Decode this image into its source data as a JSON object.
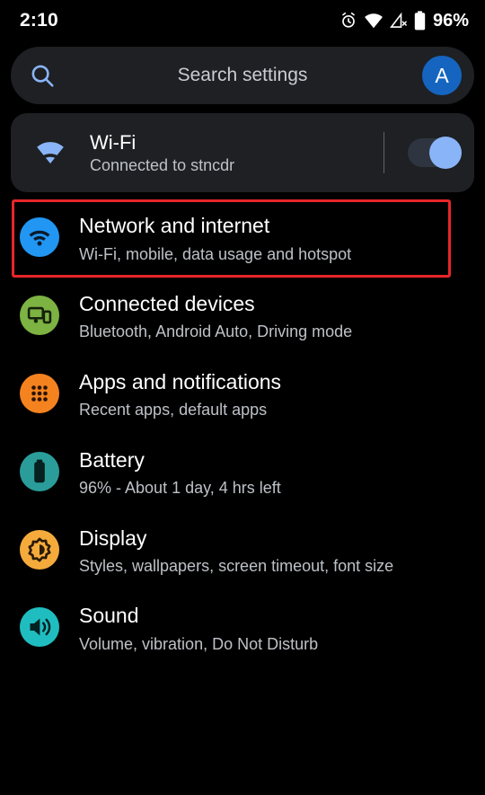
{
  "status_bar": {
    "time": "2:10",
    "battery_percent": "96%",
    "icons": [
      "alarm-icon",
      "wifi-icon",
      "cellular-off-icon",
      "battery-icon"
    ]
  },
  "search": {
    "placeholder": "Search settings",
    "icon": "search-icon",
    "avatar_letter": "A",
    "avatar_color": "#1565c0"
  },
  "wifi_card": {
    "icon": "wifi-icon",
    "title": "Wi-Fi",
    "subtitle": "Connected to stncdr",
    "toggle_state": "on",
    "toggle_color": "#8ab4f8"
  },
  "highlight": {
    "color": "#e8252b",
    "target": "Network and internet"
  },
  "settings": [
    {
      "title": "Network and internet",
      "subtitle": "Wi-Fi, mobile, data usage and hotspot",
      "icon": "network-wifi-icon",
      "icon_color": "#2196f3",
      "highlighted": true
    },
    {
      "title": "Connected devices",
      "subtitle": "Bluetooth, Android Auto, Driving mode",
      "icon": "connected-devices-icon",
      "icon_color": "#7cb342",
      "highlighted": false
    },
    {
      "title": "Apps and notifications",
      "subtitle": "Recent apps, default apps",
      "icon": "apps-grid-icon",
      "icon_color": "#f4831f",
      "highlighted": false
    },
    {
      "title": "Battery",
      "subtitle": "96% - About 1 day, 4 hrs left",
      "icon": "battery-icon",
      "icon_color": "#2a9d9a",
      "highlighted": false
    },
    {
      "title": "Display",
      "subtitle": "Styles, wallpapers, screen timeout, font size",
      "icon": "brightness-icon",
      "icon_color": "#f5ab3c",
      "highlighted": false
    },
    {
      "title": "Sound",
      "subtitle": "Volume, vibration, Do Not Disturb",
      "icon": "volume-icon",
      "icon_color": "#1fbdc0",
      "highlighted": false
    }
  ]
}
